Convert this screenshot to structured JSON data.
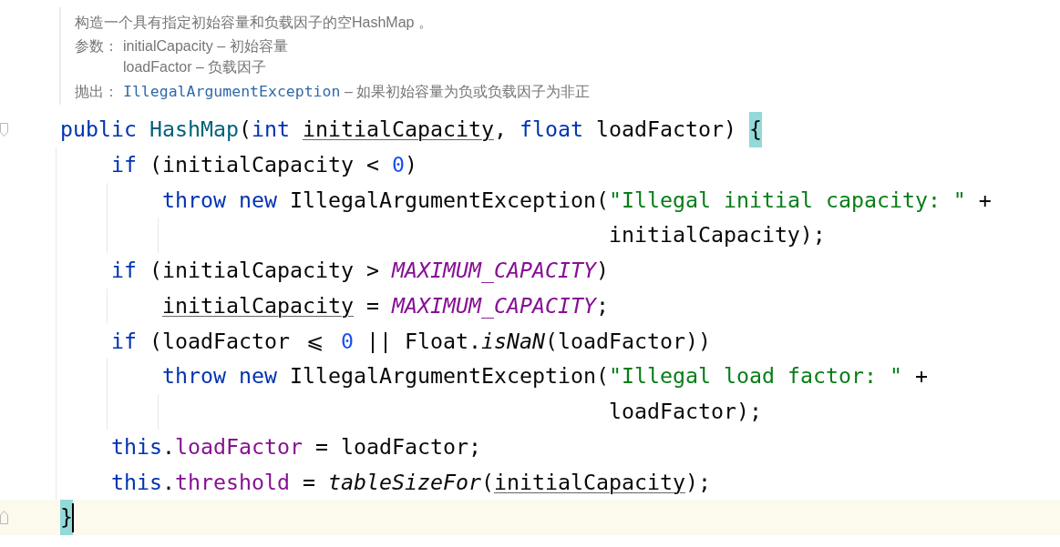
{
  "doc": {
    "summary": "构造一个具有指定初始容量和负载因子的空HashMap 。",
    "sections": [
      {
        "label": "参数：",
        "items": [
          {
            "kind": "text",
            "name": "initialCapacity",
            "description": "– 初始容量"
          },
          {
            "kind": "text",
            "name": "loadFactor",
            "description": "– 负载因子"
          }
        ]
      },
      {
        "label": "抛出：",
        "items": [
          {
            "kind": "link",
            "name": "IllegalArgumentException",
            "description": "– 如果初始容量为负或负载因子为非正"
          }
        ]
      }
    ]
  },
  "code": [
    {
      "kind": "fold-start",
      "current": false,
      "tokens": [
        {
          "text": "public ",
          "kind": "keyword"
        },
        {
          "text": "HashMap",
          "kind": "declaration"
        },
        {
          "text": "(",
          "kind": "plain"
        },
        {
          "text": "int ",
          "kind": "keyword"
        },
        {
          "text": "initialCapacity",
          "kind": "reassigned"
        },
        {
          "text": ", ",
          "kind": "plain"
        },
        {
          "text": "float ",
          "kind": "keyword"
        },
        {
          "text": "loadFactor) ",
          "kind": "plain"
        },
        {
          "text": "{",
          "kind": "brace",
          "matched": true
        }
      ],
      "children": [
        {
          "current": false,
          "tokens": [
            {
              "text": "if ",
              "kind": "keyword"
            },
            {
              "text": "(initialCapacity < ",
              "kind": "plain"
            },
            {
              "text": "0",
              "kind": "number"
            },
            {
              "text": ")",
              "kind": "plain"
            }
          ],
          "children": [
            {
              "current": false,
              "tokens": [
                {
                  "text": "throw new ",
                  "kind": "keyword"
                },
                {
                  "text": "IllegalArgumentException(",
                  "kind": "plain"
                },
                {
                  "text": "\"Illegal initial capacity: \"",
                  "kind": "string"
                },
                {
                  "text": " +",
                  "kind": "plain"
                }
              ],
              "continuation": {
                "current": false,
                "tokens": [
                  {
                    "text": "initialCapacity);",
                    "kind": "plain"
                  }
                ]
              }
            }
          ]
        },
        {
          "current": false,
          "tokens": [
            {
              "text": "if ",
              "kind": "keyword"
            },
            {
              "text": "(initialCapacity > ",
              "kind": "plain"
            },
            {
              "text": "MAXIMUM_CAPACITY",
              "kind": "constant"
            },
            {
              "text": ")",
              "kind": "plain"
            }
          ],
          "children": [
            {
              "current": false,
              "tokens": [
                {
                  "text": "initialCapacity",
                  "kind": "reassigned"
                },
                {
                  "text": " = ",
                  "kind": "plain"
                },
                {
                  "text": "MAXIMUM_CAPACITY",
                  "kind": "constant"
                },
                {
                  "text": ";",
                  "kind": "plain"
                }
              ]
            }
          ]
        },
        {
          "current": false,
          "tokens": [
            {
              "text": "if ",
              "kind": "keyword"
            },
            {
              "text": "(loadFactor ",
              "kind": "plain"
            },
            {
              "text": "⩽",
              "kind": "ligature"
            },
            {
              "text": " 0",
              "kind": "number"
            },
            {
              "text": " || Float.",
              "kind": "plain"
            },
            {
              "text": "isNaN",
              "kind": "static-call"
            },
            {
              "text": "(loadFactor))",
              "kind": "plain"
            }
          ],
          "children": [
            {
              "current": false,
              "tokens": [
                {
                  "text": "throw new ",
                  "kind": "keyword"
                },
                {
                  "text": "IllegalArgumentException(",
                  "kind": "plain"
                },
                {
                  "text": "\"Illegal load factor: \"",
                  "kind": "string"
                },
                {
                  "text": " +",
                  "kind": "plain"
                }
              ],
              "continuation": {
                "current": false,
                "tokens": [
                  {
                    "text": "loadFactor);",
                    "kind": "plain"
                  }
                ]
              }
            }
          ]
        },
        {
          "current": false,
          "tokens": [
            {
              "text": "this.",
              "kind": "qualifier"
            },
            {
              "text": "loadFactor",
              "kind": "field"
            },
            {
              "text": " = loadFactor;",
              "kind": "plain"
            }
          ]
        },
        {
          "current": false,
          "tokens": [
            {
              "text": "this.",
              "kind": "qualifier"
            },
            {
              "text": "threshold",
              "kind": "field"
            },
            {
              "text": " = ",
              "kind": "plain"
            },
            {
              "text": "tableSizeFor",
              "kind": "static-call"
            },
            {
              "text": "(",
              "kind": "plain"
            },
            {
              "text": "initialCapacity",
              "kind": "reassigned"
            },
            {
              "text": ");",
              "kind": "plain"
            }
          ]
        }
      ]
    },
    {
      "kind": "fold-end",
      "current": true,
      "tokens": [
        {
          "text": "}",
          "kind": "brace",
          "matched": true
        }
      ]
    }
  ]
}
